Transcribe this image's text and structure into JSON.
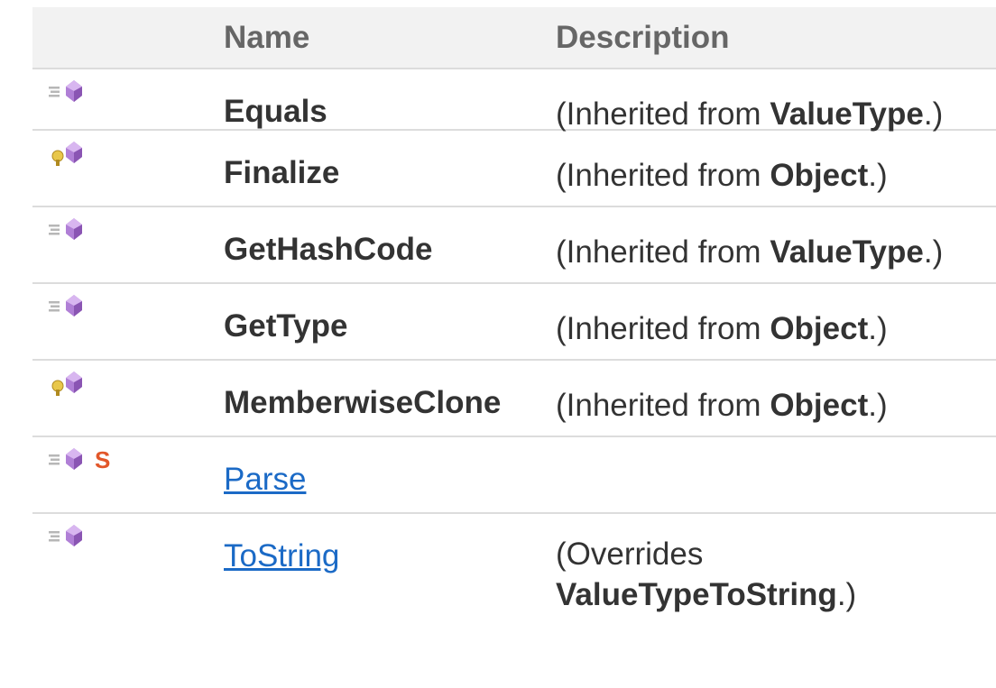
{
  "table": {
    "headers": {
      "icon": "",
      "name": "Name",
      "description": "Description"
    },
    "rows": [
      {
        "icons": [
          "public-method-icon"
        ],
        "name": "Equals",
        "is_link": false,
        "desc_prefix": "(Inherited from ",
        "desc_bold": "ValueType",
        "desc_suffix": ".)"
      },
      {
        "icons": [
          "protected-method-icon"
        ],
        "name": "Finalize",
        "is_link": false,
        "desc_prefix": "(Inherited from ",
        "desc_bold": "Object",
        "desc_suffix": ".)"
      },
      {
        "icons": [
          "public-method-icon"
        ],
        "name": "GetHashCode",
        "is_link": false,
        "desc_prefix": "(Inherited from ",
        "desc_bold": "ValueType",
        "desc_suffix": ".)"
      },
      {
        "icons": [
          "public-method-icon"
        ],
        "name": "GetType",
        "is_link": false,
        "desc_prefix": "(Inherited from ",
        "desc_bold": "Object",
        "desc_suffix": ".)"
      },
      {
        "icons": [
          "protected-method-icon"
        ],
        "name": "MemberwiseClone",
        "is_link": false,
        "desc_prefix": "(Inherited from ",
        "desc_bold": "Object",
        "desc_suffix": ".)"
      },
      {
        "icons": [
          "public-method-icon",
          "static-icon"
        ],
        "name": "Parse",
        "is_link": true,
        "desc_prefix": "",
        "desc_bold": "",
        "desc_suffix": ""
      },
      {
        "icons": [
          "public-method-icon"
        ],
        "name": "ToString",
        "is_link": true,
        "desc_prefix": "(Overrides",
        "desc_bold": "ValueTypeToString",
        "desc_suffix": ".)"
      }
    ]
  },
  "colors": {
    "link": "#1b6ac6",
    "header_bg": "#f2f2f2",
    "border": "#dcdcdc",
    "method_purple": "#b07fd6",
    "static_orange": "#e2572a"
  }
}
